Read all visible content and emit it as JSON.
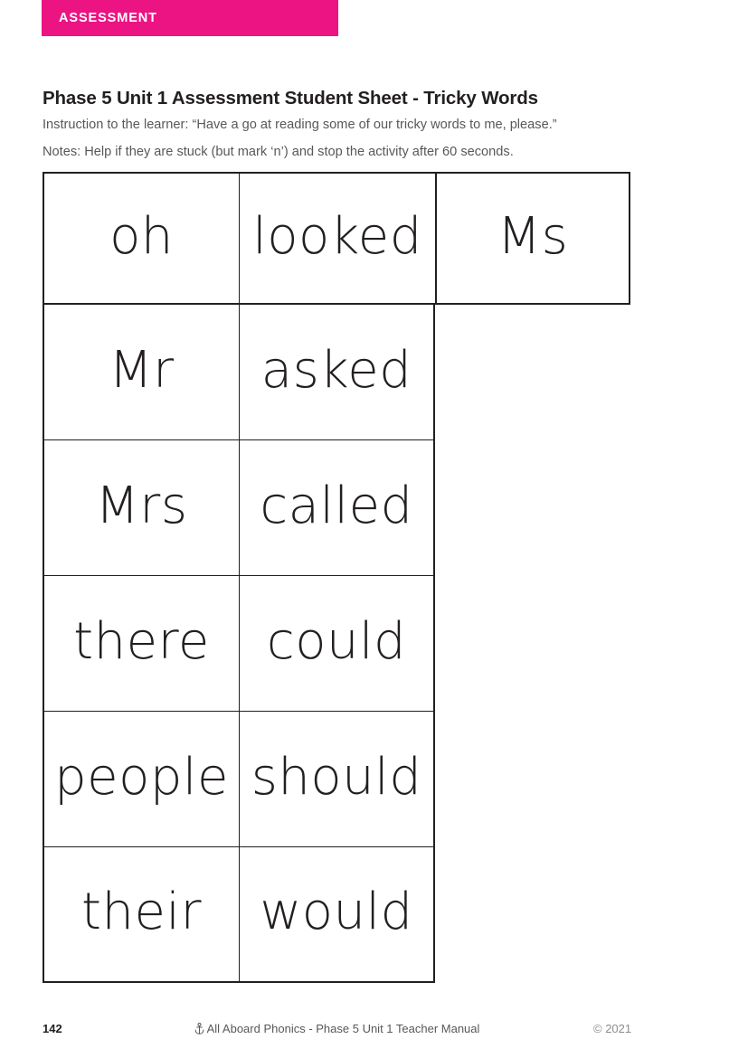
{
  "banner": {
    "label": "ASSESSMENT",
    "color": "#ec1383",
    "text_color": "#ffffff"
  },
  "heading": {
    "title": "Phase 5 Unit 1 Assessment Student Sheet - Tricky Words",
    "instruction": "Instruction to the learner: “Have a go at reading some of our tricky words to me, please.”",
    "notes": "Notes: Help if they are stuck (but mark ‘n’) and stop the activity after 60 seconds."
  },
  "grid": {
    "rows": [
      {
        "cells": [
          "oh",
          "looked",
          "Ms"
        ]
      },
      {
        "cells": [
          "Mr",
          "asked"
        ]
      },
      {
        "cells": [
          "Mrs",
          "called"
        ]
      },
      {
        "cells": [
          "there",
          "could"
        ]
      },
      {
        "cells": [
          "people",
          "should"
        ]
      },
      {
        "cells": [
          "their",
          "would"
        ]
      }
    ]
  },
  "footer": {
    "page_number": "142",
    "icon": "anchor-icon",
    "center_text": "All Aboard Phonics - Phase 5 Unit 1 Teacher Manual",
    "copyright": "© 2021"
  }
}
